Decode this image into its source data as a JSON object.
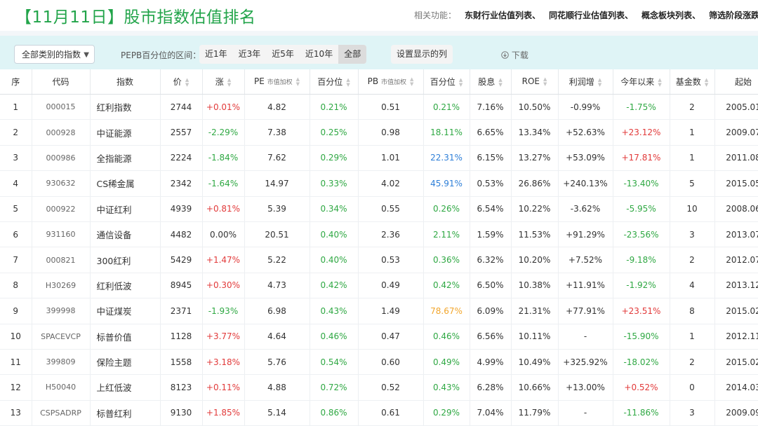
{
  "header": {
    "title": "【11月11日】股市指数估值排名",
    "related_label": "相关功能：",
    "related_links": [
      "东财行业估值列表、",
      "同花顺行业估值列表、",
      "概念板块列表、",
      "筛选阶段涨跌幅"
    ]
  },
  "toolbar": {
    "category_select": "全部类别的指数",
    "range_label": "PEPB百分位的区间：",
    "ranges": [
      "近1年",
      "近3年",
      "近5年",
      "近10年",
      "全部"
    ],
    "active_range": "全部",
    "columns_button": "设置显示的列",
    "download_label": "下载"
  },
  "table": {
    "headers": [
      {
        "label": "序",
        "sub": "",
        "sortable": false
      },
      {
        "label": "代码",
        "sub": "",
        "sortable": false
      },
      {
        "label": "指数",
        "sub": "",
        "sortable": false
      },
      {
        "label": "价",
        "sub": "",
        "sortable": true
      },
      {
        "label": "涨",
        "sub": "",
        "sortable": true
      },
      {
        "label": "PE",
        "sub": "市值加权",
        "sortable": true
      },
      {
        "label": "百分位",
        "sub": "",
        "sortable": true
      },
      {
        "label": "PB",
        "sub": "市值加权",
        "sortable": true
      },
      {
        "label": "百分位",
        "sub": "",
        "sortable": true
      },
      {
        "label": "股息",
        "sub": "",
        "sortable": true
      },
      {
        "label": "ROE",
        "sub": "",
        "sortable": true
      },
      {
        "label": "利润增",
        "sub": "",
        "sortable": true
      },
      {
        "label": "今年以来",
        "sub": "",
        "sortable": true
      },
      {
        "label": "基金数",
        "sub": "",
        "sortable": true
      },
      {
        "label": "起始",
        "sub": "",
        "sortable": false
      }
    ],
    "rows": [
      [
        "1",
        "000015",
        "红利指数",
        "2744",
        "+0.01%",
        "4.82",
        "0.21%",
        "0.51",
        "0.21%",
        "7.16%",
        "10.50%",
        "-0.99%",
        "-1.75%",
        "2",
        "2005.01"
      ],
      [
        "2",
        "000928",
        "中证能源",
        "2557",
        "-2.29%",
        "7.38",
        "0.25%",
        "0.98",
        "18.11%",
        "6.65%",
        "13.34%",
        "+52.63%",
        "+23.12%",
        "1",
        "2009.07"
      ],
      [
        "3",
        "000986",
        "全指能源",
        "2224",
        "-1.84%",
        "7.62",
        "0.29%",
        "1.01",
        "22.31%",
        "6.15%",
        "13.27%",
        "+53.09%",
        "+17.81%",
        "1",
        "2011.08"
      ],
      [
        "4",
        "930632",
        "CS稀金属",
        "2342",
        "-1.64%",
        "14.97",
        "0.33%",
        "4.02",
        "45.91%",
        "0.53%",
        "26.86%",
        "+240.13%",
        "-13.40%",
        "5",
        "2015.05"
      ],
      [
        "5",
        "000922",
        "中证红利",
        "4939",
        "+0.81%",
        "5.39",
        "0.34%",
        "0.55",
        "0.26%",
        "6.54%",
        "10.22%",
        "-3.62%",
        "-5.95%",
        "10",
        "2008.06"
      ],
      [
        "6",
        "931160",
        "通信设备",
        "4482",
        "0.00%",
        "20.51",
        "0.40%",
        "2.36",
        "2.11%",
        "1.59%",
        "11.53%",
        "+91.29%",
        "-23.56%",
        "3",
        "2013.07"
      ],
      [
        "7",
        "000821",
        "300红利",
        "5429",
        "+1.47%",
        "5.22",
        "0.40%",
        "0.53",
        "0.36%",
        "6.32%",
        "10.20%",
        "+7.52%",
        "-9.18%",
        "2",
        "2012.07"
      ],
      [
        "8",
        "H30269",
        "红利低波",
        "8945",
        "+0.30%",
        "4.73",
        "0.42%",
        "0.49",
        "0.42%",
        "6.50%",
        "10.38%",
        "+11.91%",
        "-1.92%",
        "4",
        "2013.12"
      ],
      [
        "9",
        "399998",
        "中证煤炭",
        "2371",
        "-1.93%",
        "6.98",
        "0.43%",
        "1.49",
        "78.67%",
        "6.09%",
        "21.31%",
        "+77.91%",
        "+23.51%",
        "8",
        "2015.02"
      ],
      [
        "10",
        "SPACEVCP",
        "标普价值",
        "1128",
        "+3.77%",
        "4.64",
        "0.46%",
        "0.47",
        "0.46%",
        "6.56%",
        "10.11%",
        "-",
        "-15.90%",
        "1",
        "2012.11"
      ],
      [
        "11",
        "399809",
        "保险主题",
        "1558",
        "+3.18%",
        "5.76",
        "0.54%",
        "0.60",
        "0.49%",
        "4.99%",
        "10.49%",
        "+325.92%",
        "-18.02%",
        "2",
        "2015.02"
      ],
      [
        "12",
        "H50040",
        "上红低波",
        "8123",
        "+0.11%",
        "4.88",
        "0.72%",
        "0.52",
        "0.43%",
        "6.28%",
        "10.66%",
        "+13.00%",
        "+0.52%",
        "0",
        "2014.03"
      ],
      [
        "13",
        "CSPSADRP",
        "标普红利",
        "9130",
        "+1.85%",
        "5.14",
        "0.86%",
        "0.61",
        "0.29%",
        "7.04%",
        "11.79%",
        "-",
        "-11.86%",
        "3",
        "2009.09"
      ]
    ],
    "colors": {
      "up": "#e23a3a",
      "down": "#2fa843",
      "mid": "#2e7fd8",
      "high": "#f2a62c"
    }
  }
}
